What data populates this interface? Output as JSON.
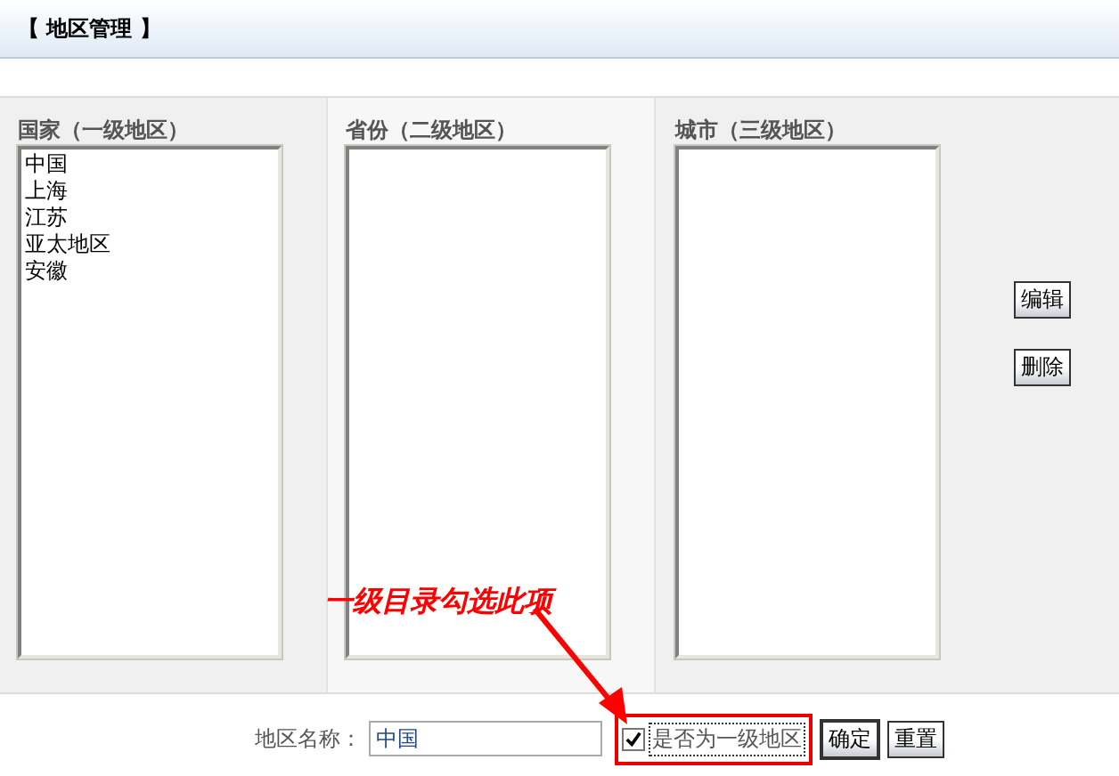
{
  "header": {
    "title": "【 地区管理 】"
  },
  "columns": [
    {
      "label": "国家（一级地区）",
      "items": [
        "中国",
        "上海",
        "江苏",
        "亚太地区",
        "安徽"
      ]
    },
    {
      "label": "省份（二级地区）"
    },
    {
      "label": "城市（三级地区）"
    }
  ],
  "side_buttons": [
    "编辑",
    "删除"
  ],
  "form": {
    "label": "地区名称：",
    "value": "中国",
    "checkbox": {
      "label": "是否为一级地区",
      "checked": true
    },
    "buttons": [
      "确定",
      "重置"
    ]
  },
  "annotation": {
    "text": "一级目录勾选此项"
  }
}
